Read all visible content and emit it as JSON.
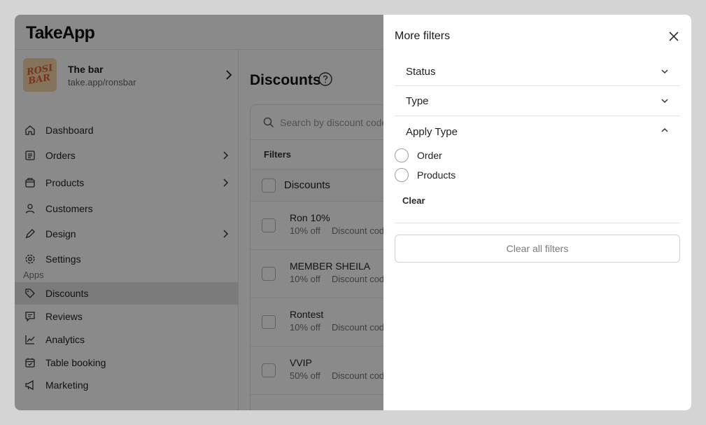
{
  "app": {
    "logo": "TakeApp"
  },
  "store": {
    "name": "The bar",
    "url": "take.app/ronsbar",
    "avatar_text": "ROSI BAR"
  },
  "sidebar": {
    "items": [
      {
        "label": "Dashboard",
        "icon": "home-icon"
      },
      {
        "label": "Orders",
        "icon": "orders-icon"
      },
      {
        "label": "Products",
        "icon": "products-icon"
      },
      {
        "label": "Customers",
        "icon": "user-icon"
      },
      {
        "label": "Design",
        "icon": "pen-icon"
      },
      {
        "label": "Settings",
        "icon": "gear-icon"
      }
    ],
    "section_label": "Apps",
    "apps": [
      {
        "label": "Discounts",
        "icon": "tag-icon"
      },
      {
        "label": "Reviews",
        "icon": "message-icon"
      },
      {
        "label": "Analytics",
        "icon": "chart-icon"
      },
      {
        "label": "Table booking",
        "icon": "calendar-icon"
      },
      {
        "label": "Marketing",
        "icon": "megaphone-icon"
      }
    ]
  },
  "main": {
    "title": "Discounts",
    "search_placeholder": "Search by discount code",
    "filters_label": "Filters",
    "table_header": "Discounts",
    "rows": [
      {
        "name": "Ron 10%",
        "percent": "10% off",
        "detail": "Discount code"
      },
      {
        "name": "MEMBER SHEILA",
        "percent": "10% off",
        "detail": "Discount code"
      },
      {
        "name": "Rontest",
        "percent": "10% off",
        "detail": "Discount code"
      },
      {
        "name": "VVIP",
        "percent": "50% off",
        "detail": "Discount code"
      }
    ]
  },
  "panel": {
    "title": "More filters",
    "sections": [
      {
        "label": "Status"
      },
      {
        "label": "Type"
      },
      {
        "label": "Apply Type"
      }
    ],
    "apply_type_options": [
      "Order",
      "Products"
    ],
    "clear_label": "Clear",
    "clear_all_label": "Clear all filters"
  }
}
